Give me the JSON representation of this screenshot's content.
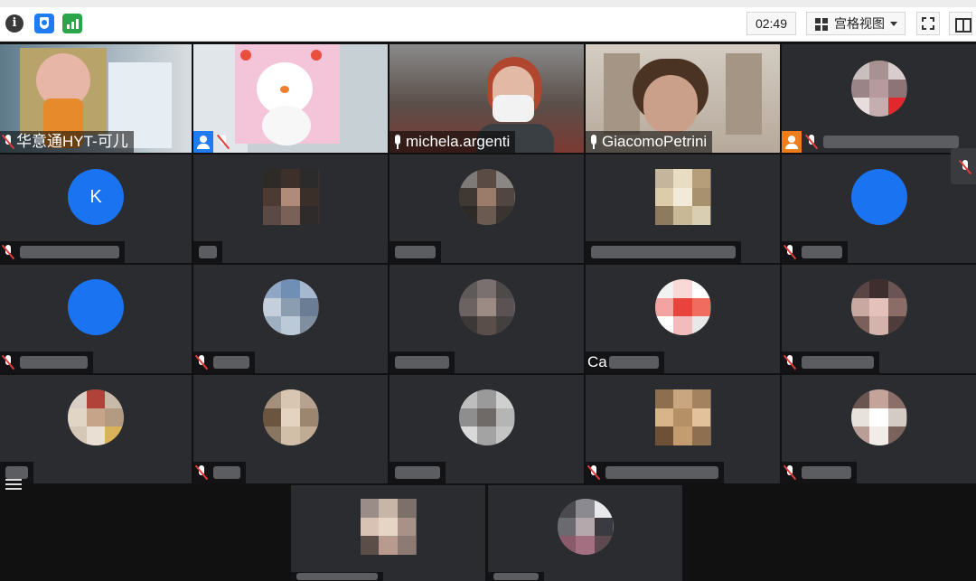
{
  "toolbar": {
    "timer": "02:49",
    "view_label": "宫格视图",
    "colors": {
      "shield": "#1f7bf2",
      "signal": "#2aa54a",
      "muted": "#e23c3c",
      "avatar_blue": "#1a73f0",
      "host_orange": "#f07d1a",
      "host_blue": "#1f7bf2"
    }
  },
  "participants": [
    {
      "name": "华意通HYT-可儿",
      "mic": "muted",
      "video": true
    },
    {
      "name": "",
      "mic": "muted",
      "video": true,
      "host": true
    },
    {
      "name": "michela.argenti",
      "mic": "on",
      "video": true
    },
    {
      "name": "GiacomoPetrini",
      "mic": "on",
      "video": true
    },
    {
      "name": "",
      "mic": "muted",
      "video": false,
      "host": true
    },
    {
      "name": "",
      "mic": "muted",
      "avatar_letter": "K"
    },
    {
      "name": "",
      "mic": "muted"
    },
    {
      "name": "",
      "mic": "muted"
    },
    {
      "name": "",
      "mic": "muted"
    },
    {
      "name": "",
      "mic": "muted"
    },
    {
      "name": "",
      "mic": "muted"
    },
    {
      "name": "",
      "mic": "muted"
    },
    {
      "name": "",
      "mic": "muted"
    },
    {
      "name": "Ca",
      "mic": "none"
    },
    {
      "name": "",
      "mic": "muted"
    },
    {
      "name": "",
      "mic": "muted"
    },
    {
      "name": "",
      "mic": "muted"
    },
    {
      "name": "",
      "mic": "muted"
    },
    {
      "name": "",
      "mic": "muted"
    },
    {
      "name": "",
      "mic": "muted"
    },
    {
      "name": "",
      "mic": "muted"
    },
    {
      "name": "",
      "mic": "muted"
    }
  ]
}
